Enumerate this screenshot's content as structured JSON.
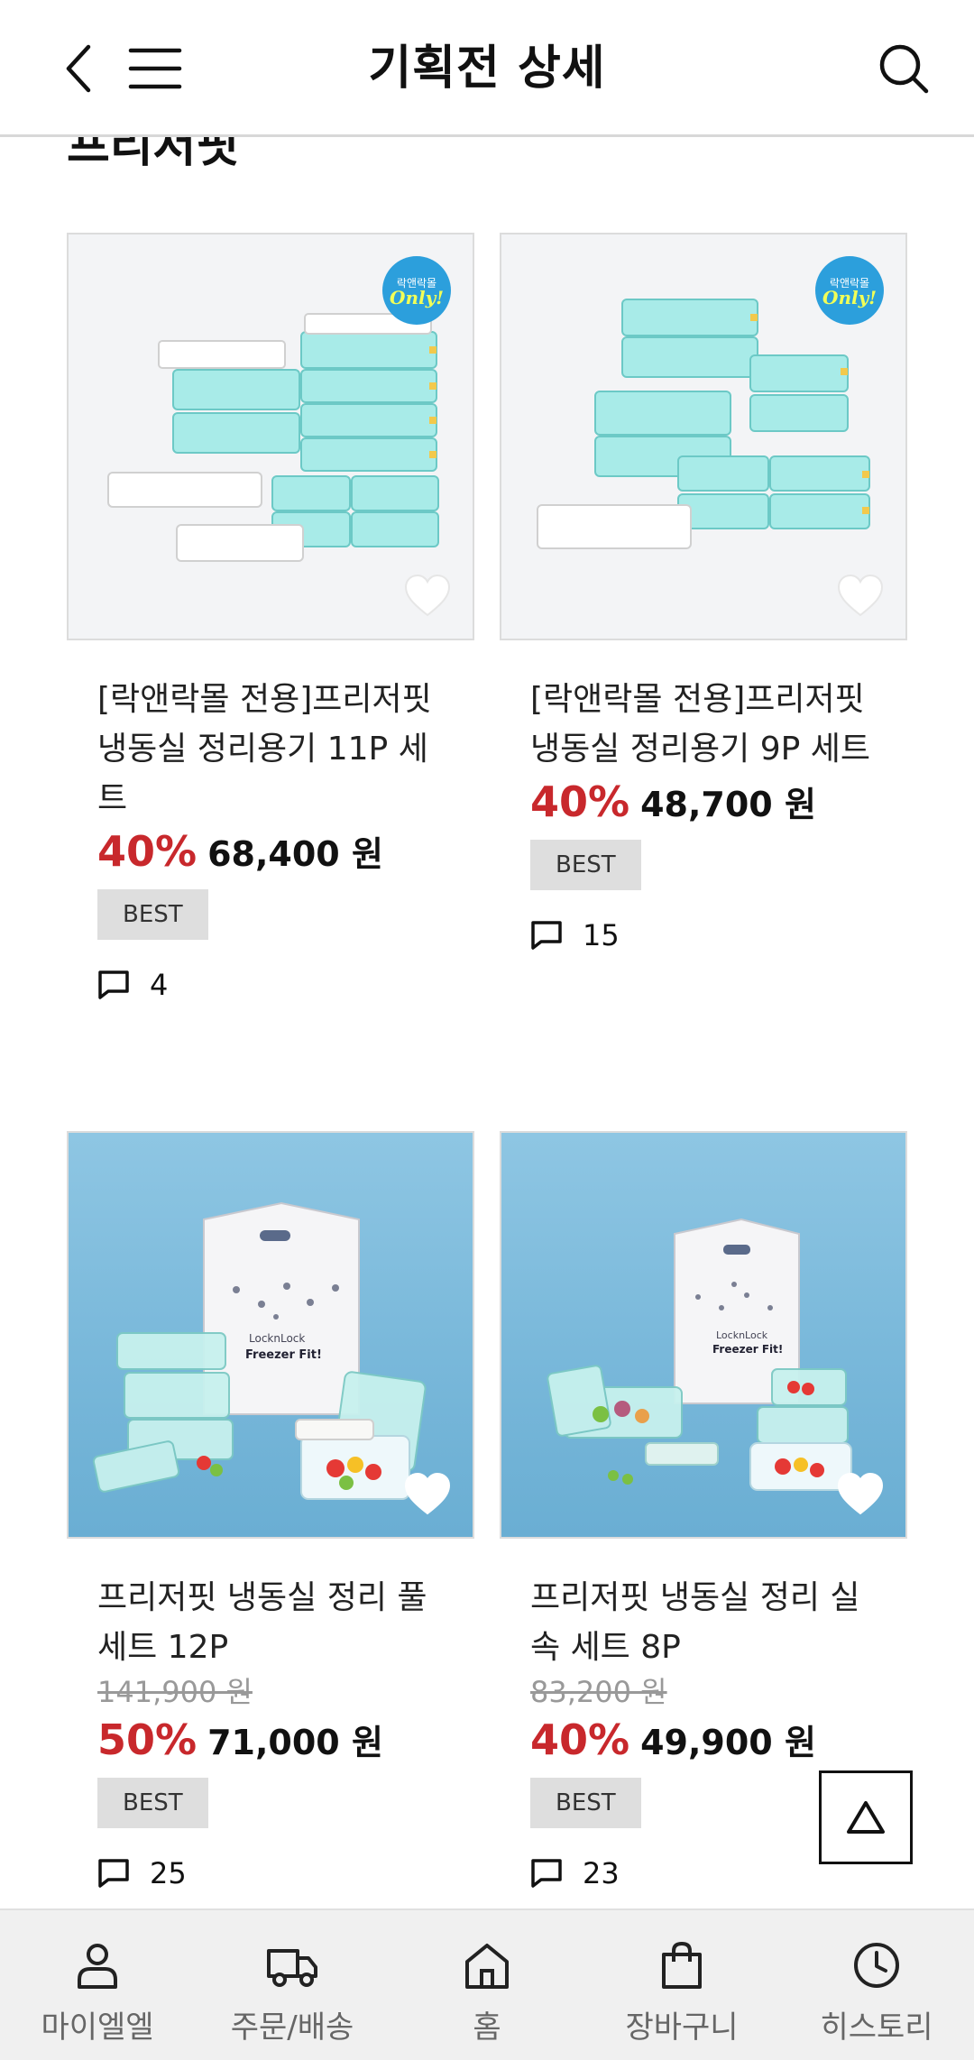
{
  "header": {
    "title": "기획전 상세"
  },
  "section": {
    "title": "프리저핏"
  },
  "products": [
    {
      "name": "[락앤락몰 전용]프리저핏 냉동실 정리용기 11P 세트",
      "original_price": "",
      "discount": "40%",
      "price": "68,400 원",
      "badge": "BEST",
      "review_count": "4",
      "only_badge": {
        "top": "락앤락몰",
        "bottom": "Only!"
      },
      "image_style": "light"
    },
    {
      "name": "[락앤락몰 전용]프리저핏 냉동실 정리용기 9P 세트",
      "original_price": "",
      "discount": "40%",
      "price": "48,700 원",
      "badge": "BEST",
      "review_count": "15",
      "only_badge": {
        "top": "락앤락몰",
        "bottom": "Only!"
      },
      "image_style": "light"
    },
    {
      "name": "프리저핏 냉동실 정리 풀세트 12P",
      "original_price": "141,900 원",
      "discount": "50%",
      "price": "71,000 원",
      "badge": "BEST",
      "review_count": "25",
      "image_style": "blue"
    },
    {
      "name": "프리저핏 냉동실 정리 실속 세트 8P",
      "original_price": "83,200 원",
      "discount": "40%",
      "price": "49,900 원",
      "badge": "BEST",
      "review_count": "23",
      "image_style": "blue"
    }
  ],
  "bottom_nav": [
    {
      "label": "마이엘엘",
      "icon": "person-icon"
    },
    {
      "label": "주문/배송",
      "icon": "truck-icon"
    },
    {
      "label": "홈",
      "icon": "home-icon"
    },
    {
      "label": "장바구니",
      "icon": "bag-icon"
    },
    {
      "label": "히스토리",
      "icon": "clock-icon"
    }
  ],
  "colors": {
    "discount": "#c8282c",
    "accent_badge": "#2c9fdc",
    "nav_bg": "#f0f0f0"
  }
}
